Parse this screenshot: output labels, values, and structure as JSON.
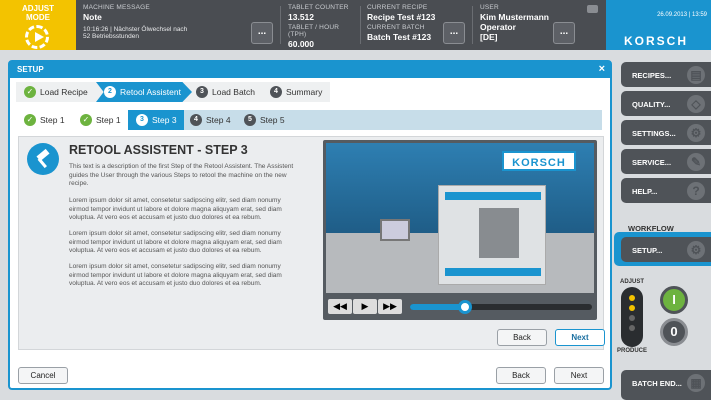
{
  "topbar": {
    "adjust_mode": "ADJUST MODE",
    "machine_message_label": "MACHINE MESSAGE",
    "machine_message_value": "Note",
    "machine_message_detail_1": "10:16:26 | Nächster Ölwechsel nach",
    "machine_message_detail_2": "52 Betriebsstunden",
    "tablet_counter_label": "TABLET COUNTER",
    "tablet_counter_value": "13.512",
    "tablet_hour_label": "TABLET / HOUR (TPH)",
    "tablet_hour_value": "60.000",
    "recipe_label": "CURRENT RECIPE",
    "recipe_value": "Recipe Test #123",
    "batch_label": "CURRENT BATCH",
    "batch_value": "Batch Test #123",
    "user_label": "USER",
    "user_name": "Kim Mustermann",
    "user_role": "Operator",
    "user_lang": "[DE]",
    "datetime": "26.09.2013 | 13:59",
    "brand": "KORSCH",
    "more_label": "..."
  },
  "panel": {
    "title": "SETUP",
    "close": "×",
    "crumbs": [
      {
        "num": "✓",
        "label": "Load Recipe",
        "state": "done"
      },
      {
        "num": "2",
        "label": "Retool Assistent",
        "state": "active"
      },
      {
        "num": "3",
        "label": "Load Batch",
        "state": "todo"
      },
      {
        "num": "4",
        "label": "Summary",
        "state": "todo"
      }
    ],
    "steps": [
      {
        "num": "✓",
        "label": "Step 1",
        "state": "done"
      },
      {
        "num": "✓",
        "label": "Step 1",
        "state": "done"
      },
      {
        "num": "3",
        "label": "Step 3",
        "state": "active"
      },
      {
        "num": "4",
        "label": "Step 4",
        "state": "todo"
      },
      {
        "num": "5",
        "label": "Step 5",
        "state": "todo"
      }
    ],
    "heading": "RETOOL ASSISTENT - STEP 3",
    "intro": "This text is a description of the first Step of the Retool Assistent. The Assistent guides the User through the various Steps to retool the machine on the new recipe.",
    "para": "Lorem ipsum dolor sit amet, consetetur sadipscing elitr, sed diam nonumy eirmod tempor invidunt ut labore et dolore magna aliquyam erat, sed diam voluptua. At vero eos et accusam et justo duo dolores et ea rebum.",
    "video_brand": "KORSCH",
    "video_progress": 0.3,
    "inner_back": "Back",
    "inner_next": "Next",
    "cancel": "Cancel",
    "back": "Back",
    "next": "Next"
  },
  "sidebar": {
    "recipes": "RECIPES...",
    "quality": "QUALITY...",
    "settings": "SETTINGS...",
    "service": "SERVICE...",
    "help": "HELP...",
    "workflow": "WORKFLOW",
    "setup": "SETUP...",
    "adjust": "ADJUST",
    "produce": "PRODUCE",
    "on": "I",
    "off": "0",
    "batch_end": "BATCH END..."
  },
  "colors": {
    "accent": "#1a94cf",
    "brand_yellow": "#f3c300",
    "ok_green": "#6db33f"
  }
}
